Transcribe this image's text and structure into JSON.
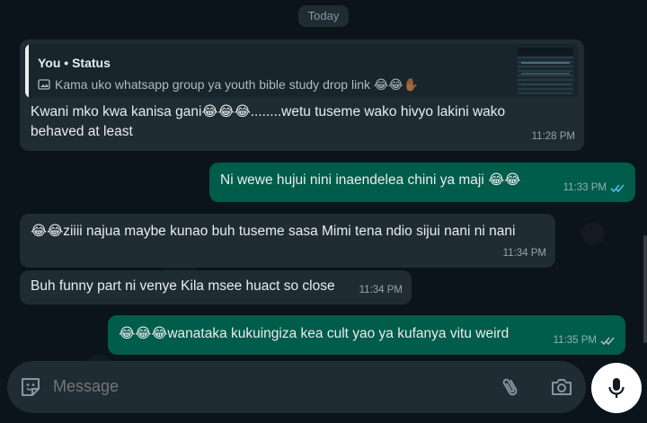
{
  "date_separator": "Today",
  "messages": [
    {
      "direction": "incoming",
      "reply_to": {
        "author": "You • Status",
        "text": "Kama uko whatsapp group ya youth bible study drop link 😂😂✋🏾",
        "icon": "photo-icon"
      },
      "lines": [
        "Kwani mko kwa kanisa gani😂😂😂........wetu tuseme wako hivyo lakini wako",
        "behaved at least"
      ],
      "time": "11:28 PM"
    },
    {
      "direction": "outgoing",
      "text": "Ni wewe hujui nini inaendelea chini ya maji 😂😂",
      "time": "11:33 PM",
      "status": "read"
    },
    {
      "direction": "incoming",
      "text": "😂😂ziiii najua maybe kunao buh tuseme sasa Mimi tena ndio sijui nani ni nani",
      "time": "11:34 PM"
    },
    {
      "direction": "incoming",
      "text": "Buh funny part ni venye Kila msee huact so close",
      "time": "11:34 PM"
    },
    {
      "direction": "outgoing",
      "text": "😂😂😂wanataka kukuingiza kea cult yao ya kufanya vitu weird",
      "time": "11:35 PM",
      "status": "delivered"
    }
  ],
  "composer": {
    "placeholder": "Message",
    "left_icon": "sticker-icon",
    "attach_icon": "paperclip-icon",
    "camera_icon": "camera-icon",
    "send_icon": "mic-icon"
  },
  "colors": {
    "background": "#0b141a",
    "incoming_bubble": "#1f2c34",
    "outgoing_bubble": "#005c4b",
    "read_ticks": "#53bdeb",
    "delivered_ticks": "#8696a0"
  }
}
